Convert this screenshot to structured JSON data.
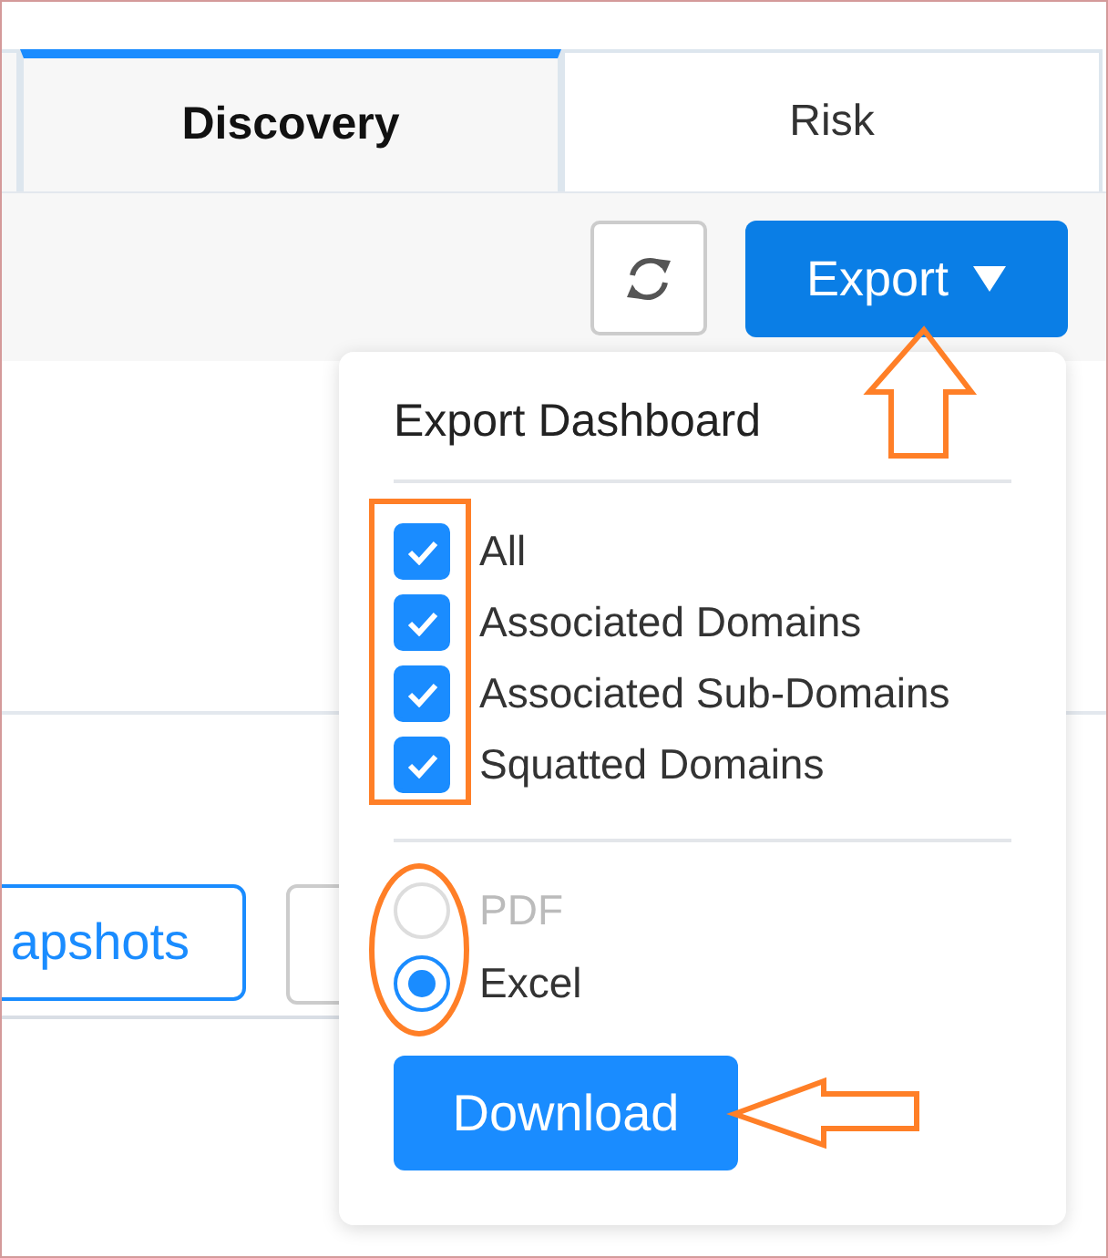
{
  "tabs": [
    {
      "label": "Discovery",
      "selected": true
    },
    {
      "label": "Risk",
      "selected": false
    }
  ],
  "toolbar": {
    "export_button": {
      "label": "Export"
    }
  },
  "snapshots_button": {
    "label": "apshots"
  },
  "export_menu": {
    "title": "Export Dashboard",
    "options": [
      {
        "label": "All",
        "checked": true
      },
      {
        "label": "Associated Domains",
        "checked": true
      },
      {
        "label": "Associated Sub-Domains",
        "checked": true
      },
      {
        "label": "Squatted Domains",
        "checked": true
      }
    ],
    "formats": [
      {
        "label": "PDF",
        "selected": false,
        "disabled": true
      },
      {
        "label": "Excel",
        "selected": true,
        "disabled": false
      }
    ],
    "download_button": {
      "label": "Download"
    }
  },
  "annotations": [
    {
      "kind": "up-arrow"
    },
    {
      "kind": "box"
    },
    {
      "kind": "ellipse"
    },
    {
      "kind": "left-arrow"
    }
  ]
}
